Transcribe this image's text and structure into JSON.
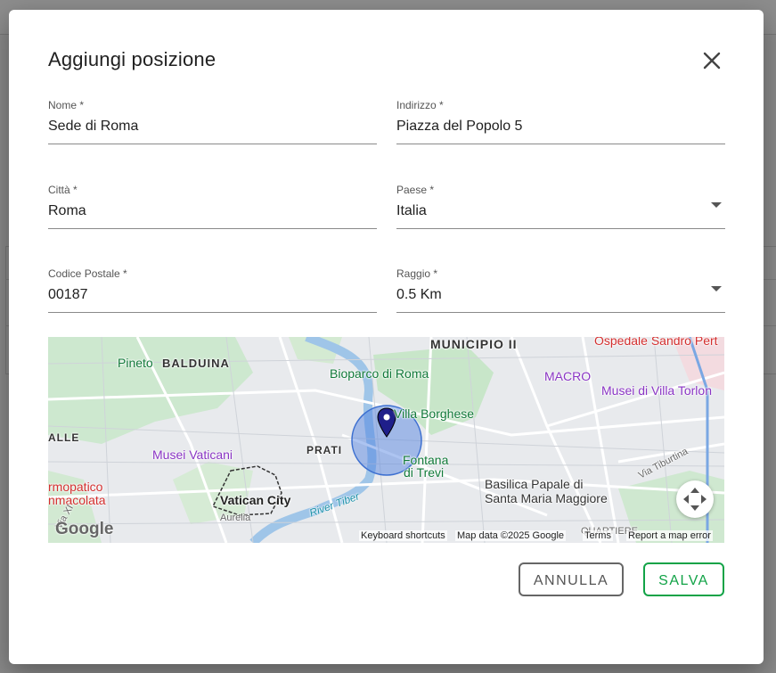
{
  "dialog": {
    "title": "Aggiungi posizione",
    "cancel_label": "ANNULLA",
    "save_label": "SALVA"
  },
  "form": {
    "name": {
      "label": "Nome *",
      "value": "Sede di Roma"
    },
    "address": {
      "label": "Indirizzo *",
      "value": "Piazza del Popolo 5"
    },
    "city": {
      "label": "Città *",
      "value": "Roma"
    },
    "country": {
      "label": "Paese *",
      "value": "Italia"
    },
    "postal_code": {
      "label": "Codice Postale *",
      "value": "00187"
    },
    "radius": {
      "label": "Raggio *",
      "value": "0.5 Km"
    }
  },
  "map": {
    "labels": {
      "municipio": "MUNICIPIO II",
      "ospedale": "Ospedale Sandro Pert",
      "pineto": "Pineto",
      "balduina": "BALDUINA",
      "bioparco": "Bioparco di Roma",
      "macro": "MACRO",
      "musei_villa": "Musei di Villa Torlon",
      "villa_borghese": "Villa Borghese",
      "prati": "PRATI",
      "alle": "ALLE",
      "musei_vaticani": "Musei Vaticani",
      "fontana": "Fontana",
      "di_trevi": "di Trevi",
      "via_tiburtina": "Via Tiburtina",
      "rmopatico": "rmopatico",
      "mmacolata": "nmacolata",
      "vatican_city": "Vatican City",
      "aurelia": "Aurelia",
      "river_tiber": "River Tiber",
      "basilica": "Basilica Papale di",
      "santa_maria": "Santa Maria Maggiore",
      "quartiere": "QUARTIERE",
      "via_xi": "Via XI"
    },
    "google_logo": "Google",
    "attribution": {
      "shortcuts": "Keyboard shortcuts",
      "data": "Map data ©2025 Google",
      "terms": "Terms",
      "report": "Report a map error"
    }
  },
  "colors": {
    "save_accent": "#12a347",
    "cancel_border": "#666666",
    "radius_fill": "#4a7de0",
    "park_green": "#c8e6c9"
  },
  "icons": {
    "close": "close-icon",
    "dropdown": "chevron-down-icon",
    "marker": "map-marker-icon",
    "recenter": "map-move-icon"
  }
}
